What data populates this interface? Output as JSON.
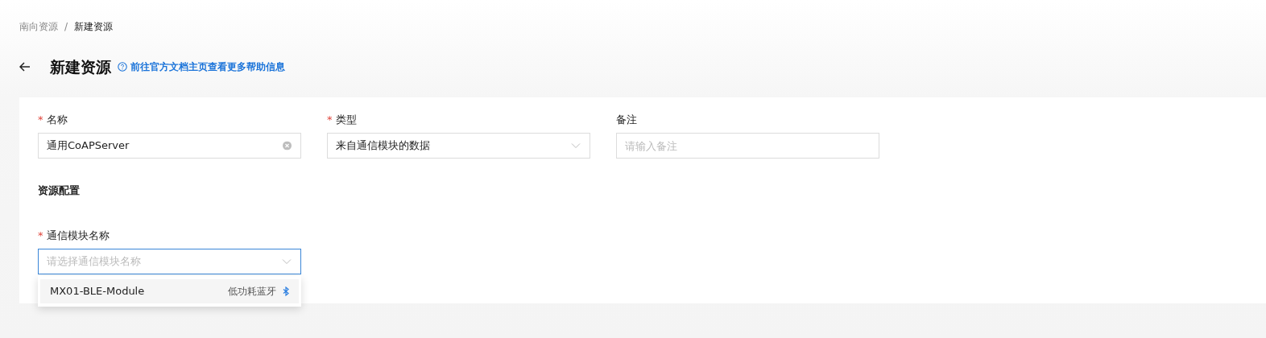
{
  "breadcrumb": [
    {
      "label": "南向资源",
      "current": false
    },
    {
      "label": "新建资源",
      "current": true
    }
  ],
  "separator": "/",
  "required_mark": "*",
  "title": "新建资源",
  "help_link": "前往官方文档主页查看更多帮助信息",
  "fields": [
    {
      "label": "名称",
      "required": true,
      "kind": "text",
      "value": "通用CoAPServer",
      "clearable": true,
      "focused": false
    },
    {
      "label": "类型",
      "required": true,
      "kind": "select",
      "value": "来自通信模块的数据",
      "focused": false
    },
    {
      "label": "备注",
      "required": false,
      "kind": "text",
      "placeholder": "请输入备注",
      "focused": false
    }
  ],
  "section_title": "资源配置",
  "config_fields": [
    {
      "label": "通信模块名称",
      "required": true,
      "kind": "select",
      "placeholder": "请选择通信模块名称",
      "focused": true
    }
  ],
  "dropdown_options": [
    {
      "name": "MX01-BLE-Module",
      "tag": "低功耗蓝牙",
      "selected": false
    }
  ]
}
